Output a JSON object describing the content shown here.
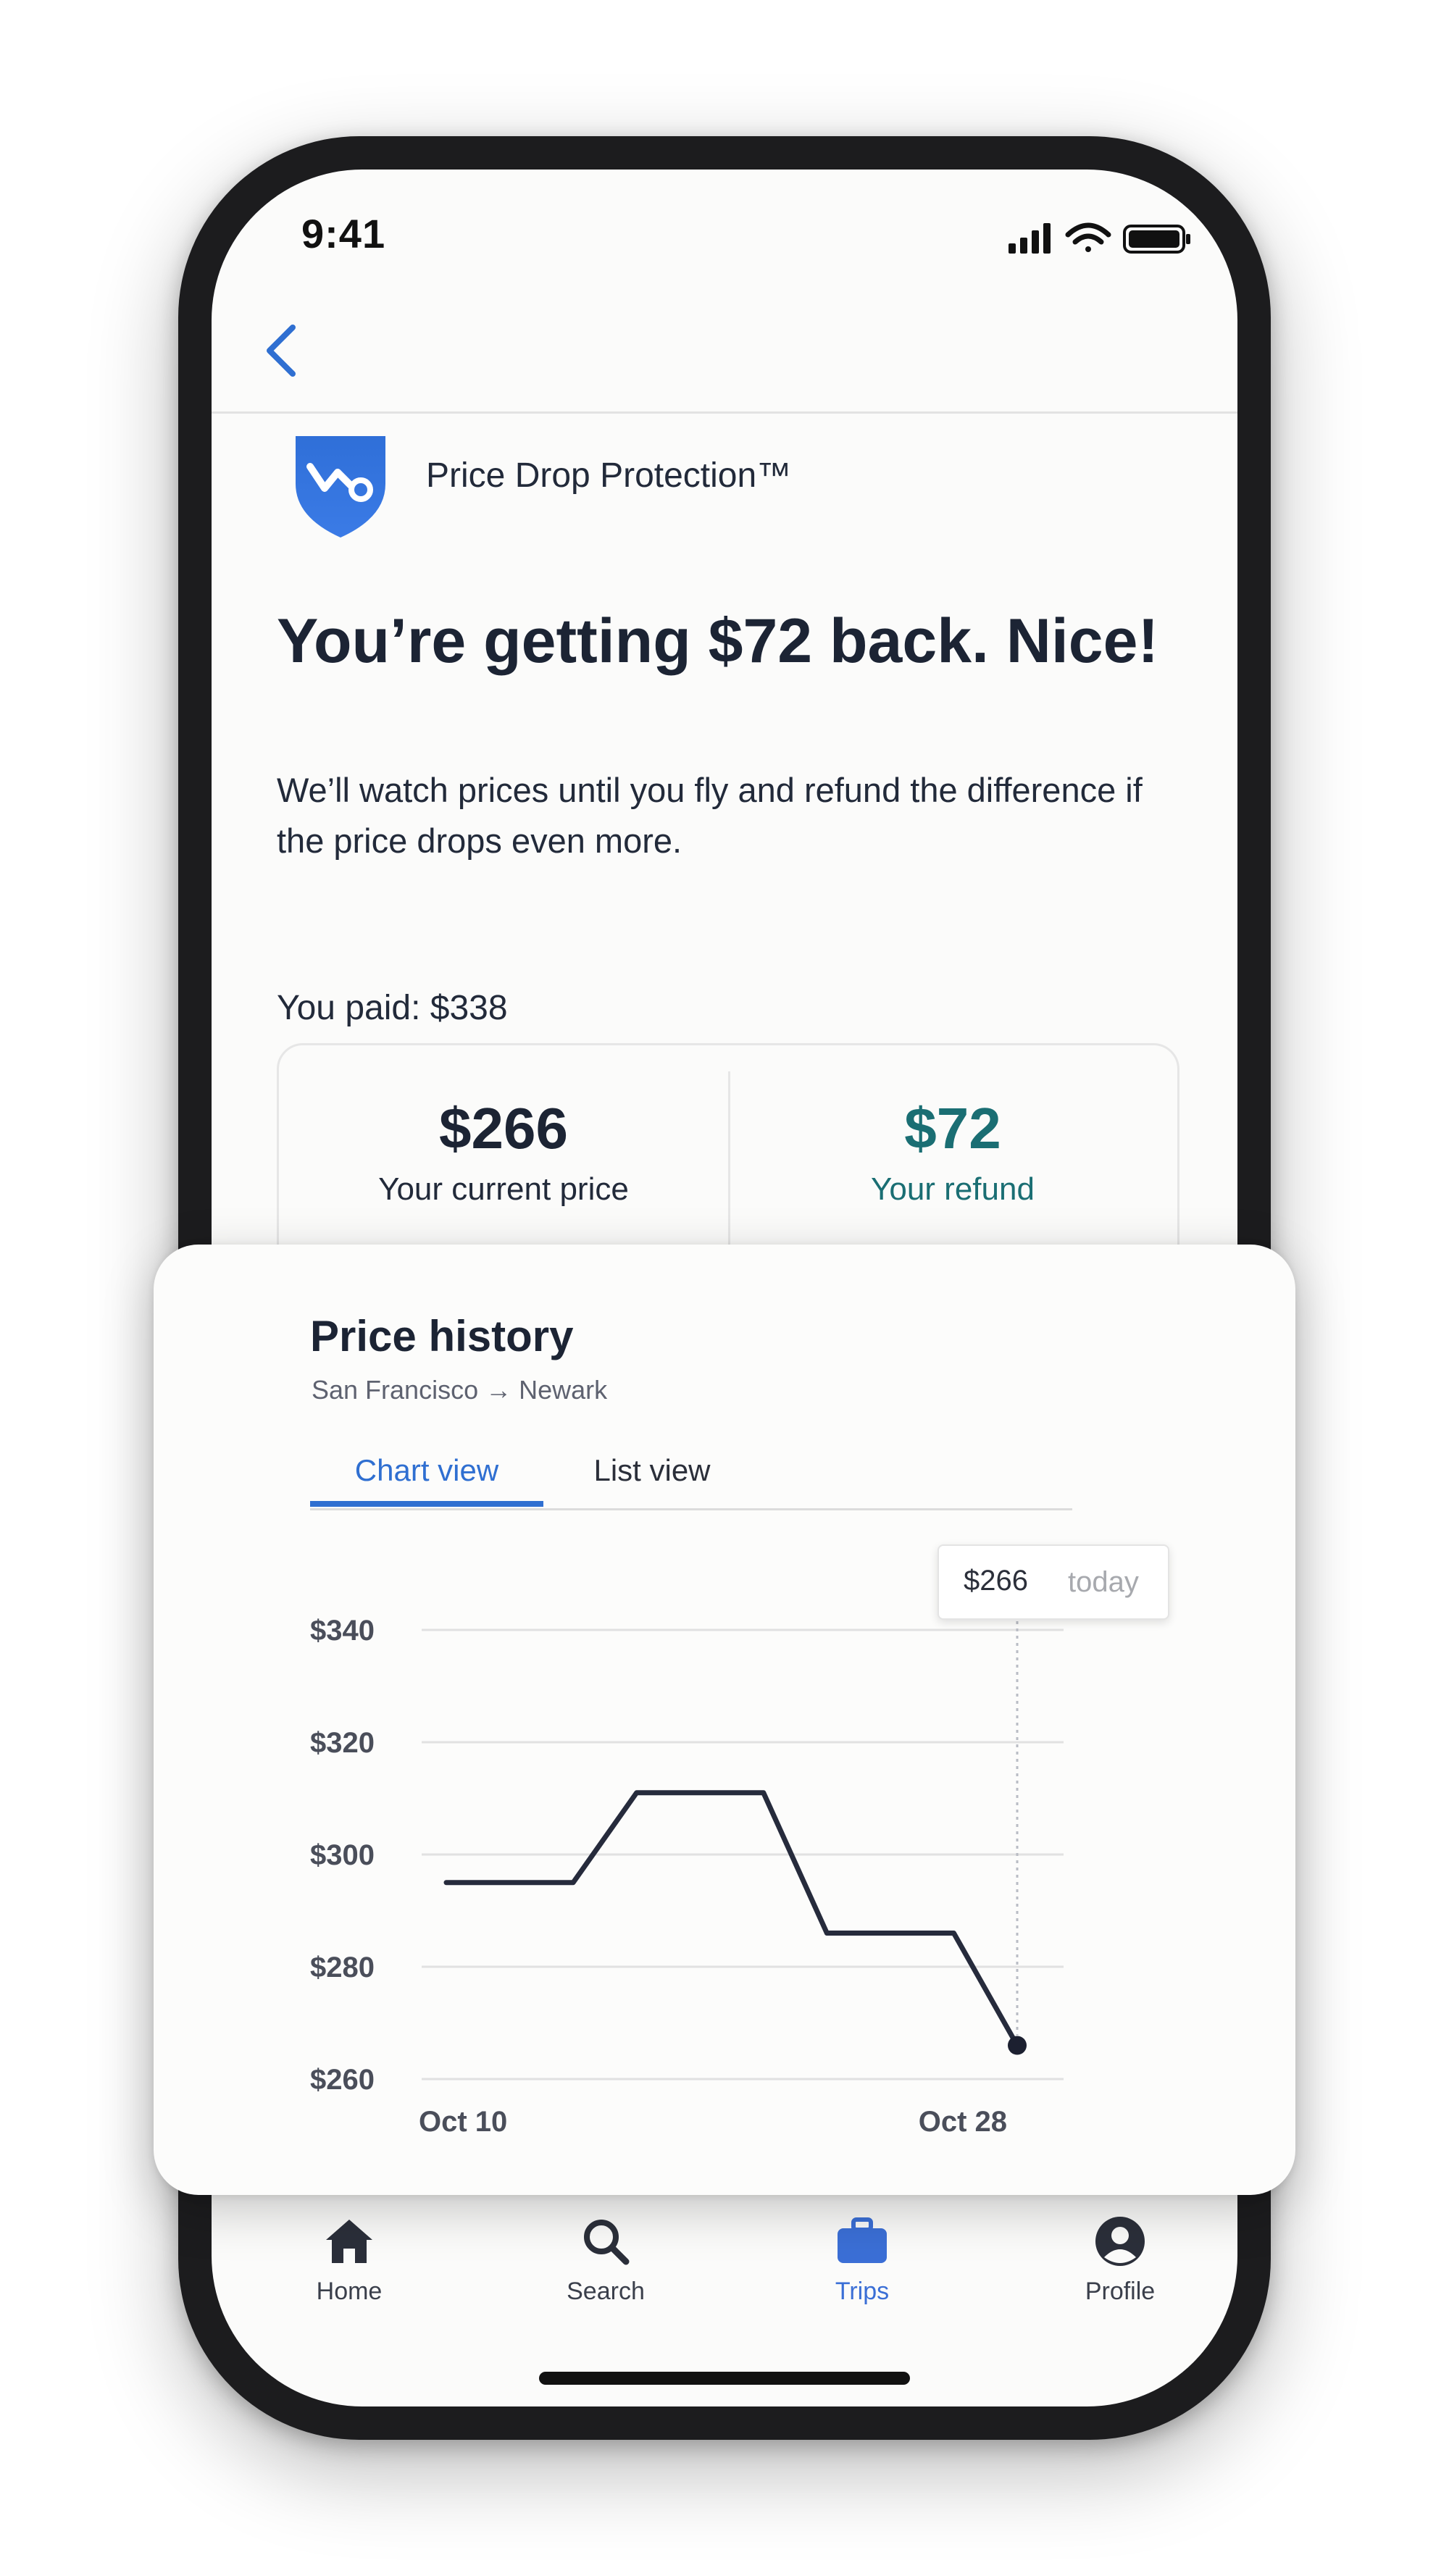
{
  "status_bar": {
    "time": "9:41"
  },
  "icons": {
    "back": "chevron-left-icon",
    "product": "shield-icon",
    "tabs": [
      "home-icon",
      "search-icon",
      "briefcase-icon",
      "profile-icon"
    ]
  },
  "colors": {
    "accent_blue": "#2f6fd1",
    "refund_teal": "#1a6e73",
    "text_dark": "#1c2434",
    "line": "#262b3c"
  },
  "header": {
    "product_name": "Price Drop Protection™"
  },
  "main": {
    "headline": "You’re getting $72 back. Nice!",
    "description": "We’ll watch prices until you fly and refund the difference if the price drops even more.",
    "paid_label": "You paid: $338",
    "current_price": {
      "amount": "$266",
      "label": "Your current price"
    },
    "refund": {
      "amount": "$72",
      "label": "Your refund"
    }
  },
  "price_history": {
    "title": "Price history",
    "route": "San Francisco → Newark",
    "tabs": [
      {
        "label": "Chart view",
        "active": true
      },
      {
        "label": "List view",
        "active": false
      }
    ],
    "tooltip": {
      "price": "$266",
      "when": "today"
    }
  },
  "chart_data": {
    "type": "line",
    "title": "Price history",
    "x_tick_labels": [
      "Oct 10",
      "Oct 28"
    ],
    "x": [
      "Oct 10",
      "Oct 12",
      "Oct 14",
      "Oct 16",
      "Oct 18",
      "Oct 20",
      "Oct 22",
      "Oct 24",
      "Oct 26",
      "Oct 28"
    ],
    "values": [
      295,
      295,
      295,
      311,
      311,
      311,
      286,
      286,
      286,
      266
    ],
    "y_ticks": [
      "$340",
      "$320",
      "$300",
      "$280",
      "$260"
    ],
    "y_tick_values": [
      340,
      320,
      300,
      280,
      260
    ],
    "ylim": [
      260,
      340
    ],
    "grid": true,
    "highlight": {
      "x": "Oct 28",
      "value": 266,
      "label": "$266",
      "note": "today"
    }
  },
  "tabbar": {
    "items": [
      {
        "label": "Home",
        "active": false
      },
      {
        "label": "Search",
        "active": false
      },
      {
        "label": "Trips",
        "active": true
      },
      {
        "label": "Profile",
        "active": false
      }
    ]
  }
}
